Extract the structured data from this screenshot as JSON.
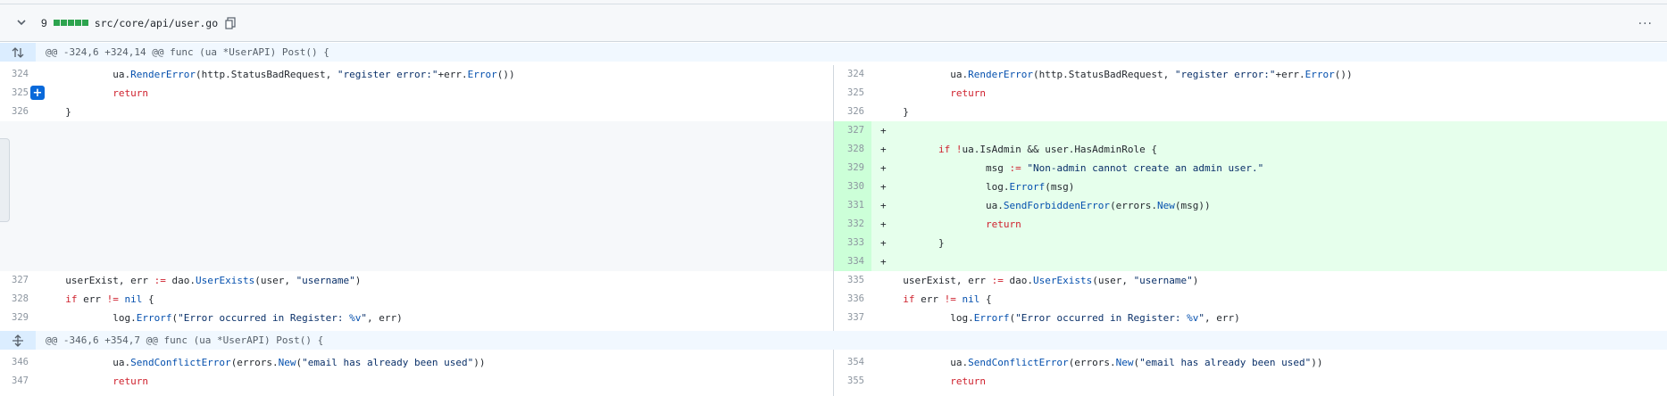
{
  "file": {
    "changes": "9",
    "path": "src/core/api/user.go"
  },
  "hunks": [
    {
      "header": "@@ -324,6 +324,14 @@ func (ua *UserAPI) Post() {"
    },
    {
      "header": "@@ -346,6 +354,7 @@ func (ua *UserAPI) Post() {"
    }
  ],
  "lines": {
    "l324": "324",
    "l325": "325",
    "l326": "326",
    "r324": "324",
    "r325": "325",
    "r326": "326",
    "r327": "327",
    "r328": "328",
    "r329": "329",
    "r330": "330",
    "r331": "331",
    "r332": "332",
    "r333": "333",
    "r334": "334",
    "l327": "327",
    "l328": "328",
    "l329": "329",
    "r335": "335",
    "r336": "336",
    "r337": "337",
    "l346": "346",
    "l347": "347",
    "r354": "354",
    "r355": "355"
  },
  "added_lines": [
    {
      "num": "327",
      "text": ""
    },
    {
      "num": "328",
      "text": "        if !ua.IsAdmin && user.HasAdminRole {"
    },
    {
      "num": "329",
      "text": "                msg := \"Non-admin cannot create an admin user.\""
    },
    {
      "num": "330",
      "text": "                log.Errorf(msg)"
    },
    {
      "num": "331",
      "text": "                ua.SendForbiddenError(errors.New(msg))"
    },
    {
      "num": "332",
      "text": "                return"
    },
    {
      "num": "333",
      "text": "        }"
    },
    {
      "num": "334",
      "text": ""
    }
  ],
  "plus": "+",
  "add_button": "+",
  "kebab": "···",
  "colors": {
    "added_bg": "#e6ffec",
    "added_num_bg": "#ccffd8",
    "diffstat": "#2da44e",
    "accent": "#0969da"
  },
  "icons": [
    "chevron-down-icon",
    "copy-icon",
    "kebab-icon",
    "expand-up-down-icon",
    "expand-icon"
  ]
}
